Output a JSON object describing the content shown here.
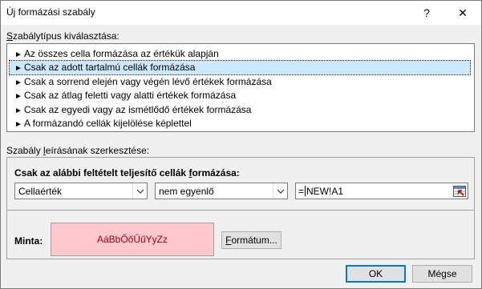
{
  "window": {
    "title": "Új formázási szabály",
    "help_label": "?",
    "close_label": "✕"
  },
  "rule_type": {
    "label_accel": "S",
    "label_rest": "zabálytípus kiválasztása:",
    "items": [
      {
        "label": "Az összes cella formázása az értékük alapján"
      },
      {
        "label": "Csak az adott tartalmú cellák formázása",
        "selected": true
      },
      {
        "label": "Csak a sorrend elején vagy végén lévő értékek formázása"
      },
      {
        "label": "Csak az átlag feletti vagy alatti értékek formázása"
      },
      {
        "label": "Csak az egyedi vagy az ismétlődő értékek formázása"
      },
      {
        "label": "A formázandó cellák kijelölése képlettel"
      }
    ]
  },
  "description": {
    "label_before": "Szabály ",
    "label_accel": "l",
    "label_rest": "eírásának szerkesztése:",
    "heading_before": "Csak az alábbi feltételt teljesítő cellák ",
    "heading_accel": "f",
    "heading_rest": "ormázása:",
    "condition_field": "Cellaérték",
    "operator": "nem egyenlő",
    "formula_before_caret": "=",
    "formula_after_caret": "NEW!A1",
    "preview_label": "Minta:",
    "preview_text": "AáBbŐőŰűYyZz",
    "format_button_accel": "F",
    "format_button_rest": "ormátum..."
  },
  "buttons": {
    "ok": "OK",
    "cancel": "Mégse"
  },
  "colors": {
    "selection": "#cce8ff",
    "preview_fill": "#ffc7ce",
    "preview_text": "#9c0006",
    "default_button_border": "#0078d7"
  }
}
